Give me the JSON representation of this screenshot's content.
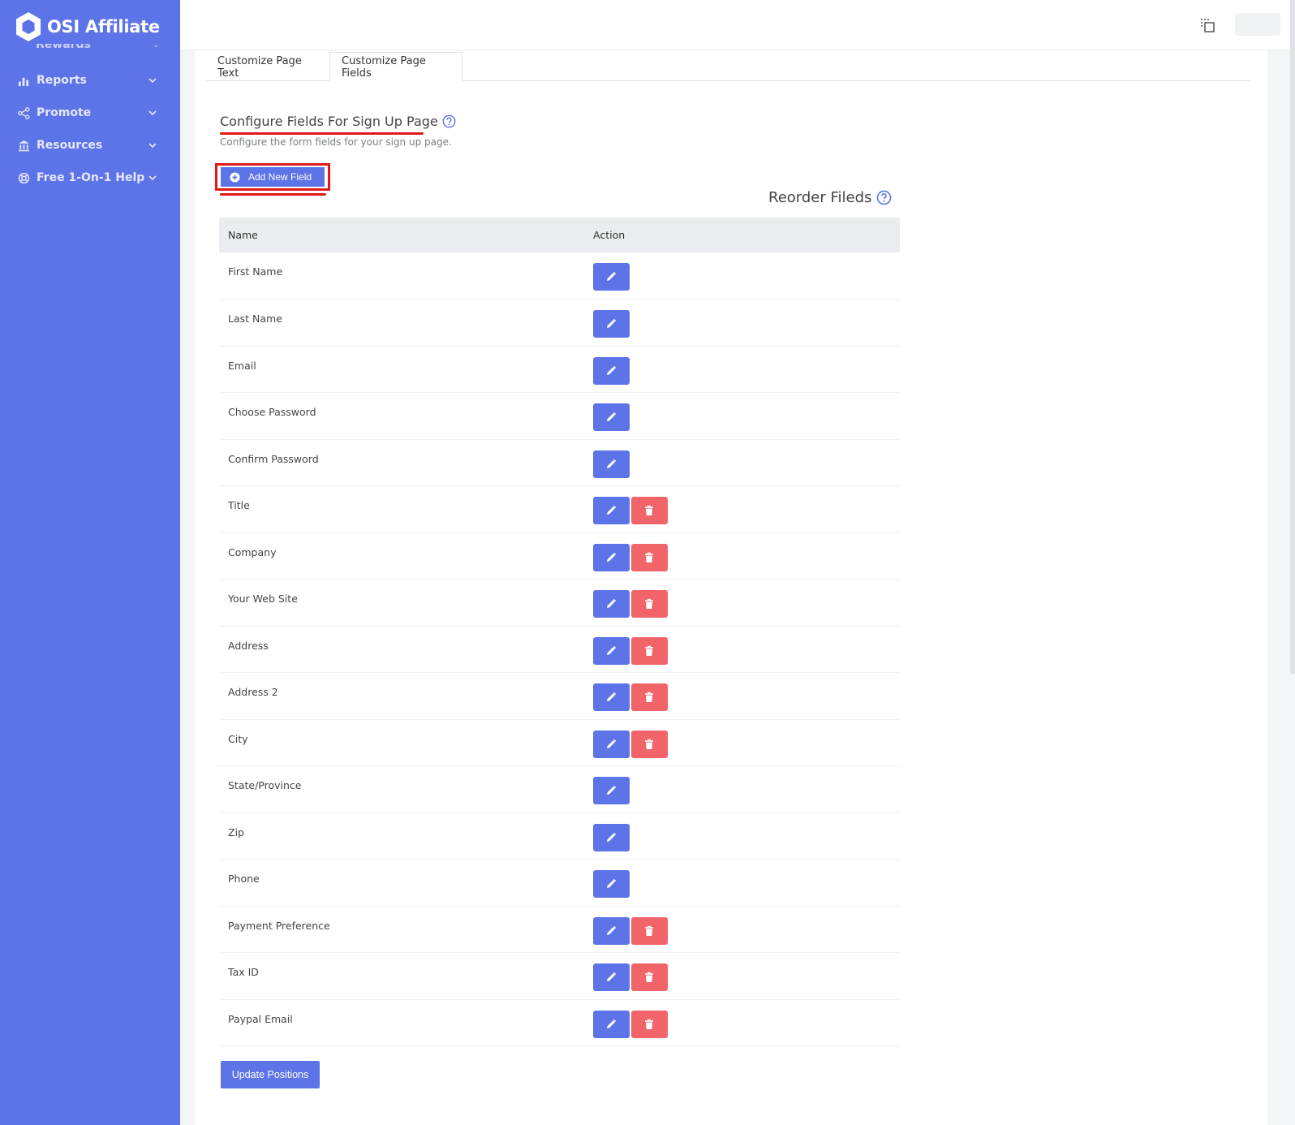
{
  "app": {
    "brand": "OSI Affiliate"
  },
  "sidebar": {
    "partial_item": "Rewards",
    "items": [
      {
        "label": "Reports",
        "icon": "bar-chart-icon"
      },
      {
        "label": "Promote",
        "icon": "share-icon"
      },
      {
        "label": "Resources",
        "icon": "bank-icon"
      },
      {
        "label": "Free 1-On-1 Help",
        "icon": "lifebuoy-icon"
      }
    ]
  },
  "tabs": [
    {
      "label": "Customize Page Text",
      "active": false
    },
    {
      "label": "Customize Page Fields",
      "active": true
    }
  ],
  "section": {
    "title": "Configure Fields For Sign Up Page",
    "subtitle": "Configure the form fields for your sign up page.",
    "add_button": "Add New Field",
    "reorder_title": "Reorder Fileds"
  },
  "table": {
    "columns": [
      "Name",
      "Action"
    ],
    "rows": [
      {
        "name": "First Name",
        "deletable": false
      },
      {
        "name": "Last Name",
        "deletable": false
      },
      {
        "name": "Email",
        "deletable": false
      },
      {
        "name": "Choose Password",
        "deletable": false
      },
      {
        "name": "Confirm Password",
        "deletable": false
      },
      {
        "name": "Title",
        "deletable": true
      },
      {
        "name": "Company",
        "deletable": true
      },
      {
        "name": "Your Web Site",
        "deletable": true
      },
      {
        "name": "Address",
        "deletable": true
      },
      {
        "name": "Address 2",
        "deletable": true
      },
      {
        "name": "City",
        "deletable": true
      },
      {
        "name": "State/Province",
        "deletable": false
      },
      {
        "name": "Zip",
        "deletable": false
      },
      {
        "name": "Phone",
        "deletable": false
      },
      {
        "name": "Payment Preference",
        "deletable": true
      },
      {
        "name": "Tax ID",
        "deletable": true
      },
      {
        "name": "Paypal Email",
        "deletable": true
      }
    ]
  },
  "footer": {
    "update_button": "Update Positions"
  },
  "colors": {
    "primary": "#5d73e8",
    "danger": "#f0646a",
    "annotation": "#e01919"
  }
}
